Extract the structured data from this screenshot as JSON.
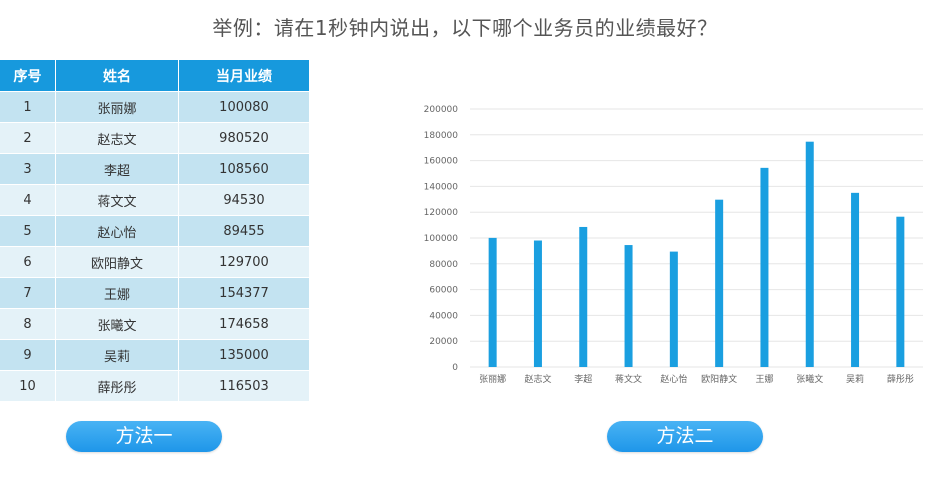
{
  "headline": "举例：请在1秒钟内说出，以下哪个业务员的业绩最好？",
  "table": {
    "headers": [
      "序号",
      "姓名",
      "当月业绩"
    ],
    "rows": [
      [
        "1",
        "张丽娜",
        "100080"
      ],
      [
        "2",
        "赵志文",
        "980520"
      ],
      [
        "3",
        "李超",
        "108560"
      ],
      [
        "4",
        "蒋文文",
        "94530"
      ],
      [
        "5",
        "赵心怡",
        "89455"
      ],
      [
        "6",
        "欧阳静文",
        "129700"
      ],
      [
        "7",
        "王娜",
        "154377"
      ],
      [
        "8",
        "张曦文",
        "174658"
      ],
      [
        "9",
        "吴莉",
        "135000"
      ],
      [
        "10",
        "薛彤彤",
        "116503"
      ]
    ]
  },
  "buttons": {
    "method1": "方法一",
    "method2": "方法二"
  },
  "colors": {
    "bar": "#1a9fe0",
    "header": "#1799dd",
    "row_odd": "#c3e3f1",
    "row_even": "#e4f2f8",
    "grid": "#e6e6e6"
  },
  "chart_data": {
    "type": "bar",
    "categories": [
      "张丽娜",
      "赵志文",
      "李超",
      "蒋文文",
      "赵心怡",
      "欧阳静文",
      "王娜",
      "张曦文",
      "吴莉",
      "薛彤彤"
    ],
    "values": [
      100080,
      98052,
      108560,
      94530,
      89455,
      129700,
      154377,
      174658,
      135000,
      116503
    ],
    "title": "",
    "xlabel": "",
    "ylabel": "",
    "ylim": [
      0,
      200000
    ],
    "yticks": [
      0,
      20000,
      40000,
      60000,
      80000,
      100000,
      120000,
      140000,
      160000,
      180000,
      200000
    ],
    "grid": true,
    "legend": "none"
  }
}
